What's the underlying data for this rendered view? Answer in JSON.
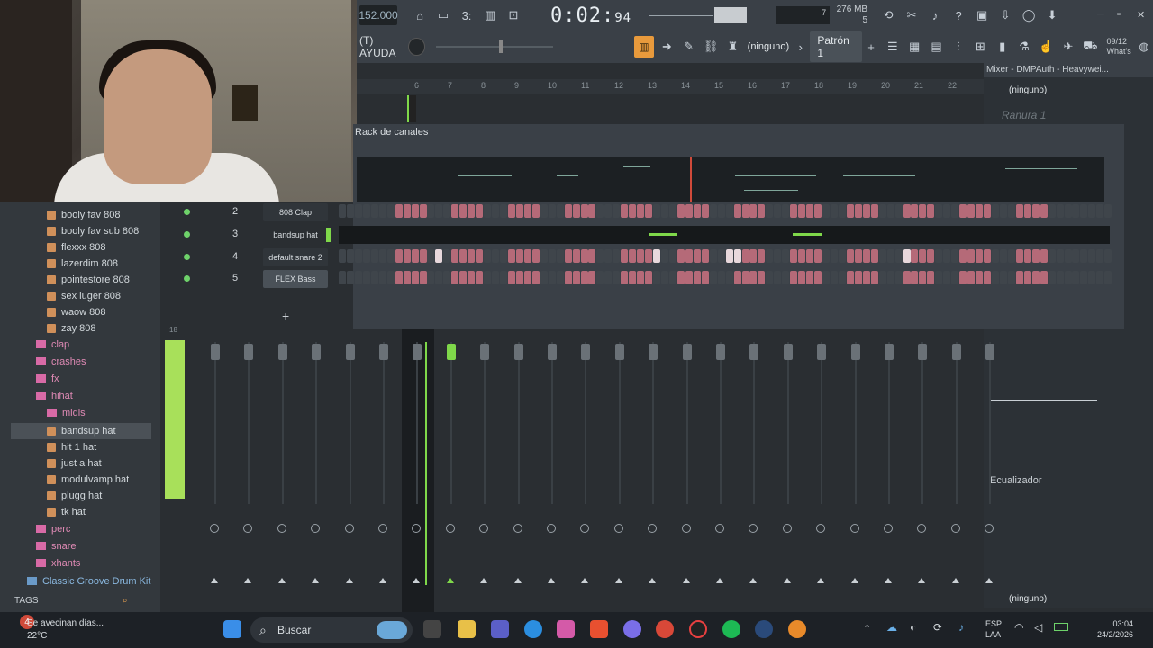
{
  "toolbar": {
    "tempo": "152.000",
    "time_main": "0:02:",
    "time_sub": "94",
    "mem_line1": "276 MB",
    "mem_line2": "5",
    "mem_small": "7",
    "news_date": "09/12",
    "news_text": "What's"
  },
  "secondbar": {
    "hint": "(T) AYUDA",
    "ninguno": "(ninguno)",
    "pattern": "Patrón 1",
    "pattern_add": "+"
  },
  "mixer_panel": {
    "title": "Mixer - DMPAuth - Heavywei...",
    "ninguno_top": "(ninguno)",
    "ranura": "Ranura 1",
    "equalizer": "Ecualizador",
    "ninguno_bottom": "(ninguno)"
  },
  "ruler": {
    "marks": [
      "6",
      "7",
      "8",
      "9",
      "10",
      "11",
      "12",
      "13",
      "14",
      "15",
      "16",
      "17",
      "18",
      "19",
      "20",
      "21",
      "22"
    ]
  },
  "rack": {
    "title": "Rack de canales",
    "channels": [
      {
        "num": "2",
        "name": "808 Clap"
      },
      {
        "num": "3",
        "name": "bandsup hat"
      },
      {
        "num": "4",
        "name": "default snare 2"
      },
      {
        "num": "5",
        "name": "FLEX Bass"
      }
    ],
    "add": "+"
  },
  "browser": {
    "items": [
      "booly fav 808",
      "booly fav sub 808",
      "flexxx 808",
      "lazerdim 808",
      "pointestore 808",
      "sex luger 808",
      "waow 808",
      "zay 808"
    ],
    "folders": [
      {
        "label": "clap",
        "indent": 1
      },
      {
        "label": "crashes",
        "indent": 1
      },
      {
        "label": "fx",
        "indent": 1
      },
      {
        "label": "hihat",
        "indent": 1
      },
      {
        "label": "midis",
        "indent": 2
      }
    ],
    "hihat_items": [
      "bandsup hat",
      "hit 1 hat",
      "just a hat",
      "modulvamp hat",
      "plugg hat",
      "tk hat"
    ],
    "folders2": [
      {
        "label": "perc"
      },
      {
        "label": "snare"
      },
      {
        "label": "xhants"
      }
    ],
    "classic": "Classic Groove Drum Kit",
    "tags": "TAGS"
  },
  "mixer": {
    "master_label": "18"
  },
  "taskbar": {
    "weather_title": "Se avecinan días...",
    "weather_temp": "22°C",
    "search": "Buscar",
    "lang1": "ESP",
    "lang2": "LAA",
    "time": "03:04",
    "date": "24/2/2026",
    "notif_badge": "4"
  },
  "colors": {
    "accent_green": "#7fd84a",
    "step_on": "#b56a78",
    "step_off": "#3f454b",
    "folder_pink": "#e08ab5",
    "orange": "#e89a3c"
  }
}
